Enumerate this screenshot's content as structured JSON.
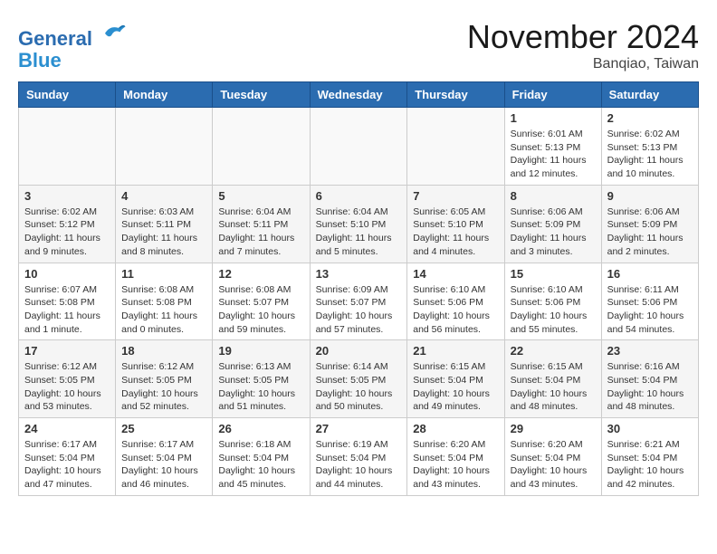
{
  "header": {
    "logo_line1": "General",
    "logo_line2": "Blue",
    "month_title": "November 2024",
    "location": "Banqiao, Taiwan"
  },
  "weekdays": [
    "Sunday",
    "Monday",
    "Tuesday",
    "Wednesday",
    "Thursday",
    "Friday",
    "Saturday"
  ],
  "weeks": [
    [
      {
        "day": "",
        "info": ""
      },
      {
        "day": "",
        "info": ""
      },
      {
        "day": "",
        "info": ""
      },
      {
        "day": "",
        "info": ""
      },
      {
        "day": "",
        "info": ""
      },
      {
        "day": "1",
        "info": "Sunrise: 6:01 AM\nSunset: 5:13 PM\nDaylight: 11 hours and 12 minutes."
      },
      {
        "day": "2",
        "info": "Sunrise: 6:02 AM\nSunset: 5:13 PM\nDaylight: 11 hours and 10 minutes."
      }
    ],
    [
      {
        "day": "3",
        "info": "Sunrise: 6:02 AM\nSunset: 5:12 PM\nDaylight: 11 hours and 9 minutes."
      },
      {
        "day": "4",
        "info": "Sunrise: 6:03 AM\nSunset: 5:11 PM\nDaylight: 11 hours and 8 minutes."
      },
      {
        "day": "5",
        "info": "Sunrise: 6:04 AM\nSunset: 5:11 PM\nDaylight: 11 hours and 7 minutes."
      },
      {
        "day": "6",
        "info": "Sunrise: 6:04 AM\nSunset: 5:10 PM\nDaylight: 11 hours and 5 minutes."
      },
      {
        "day": "7",
        "info": "Sunrise: 6:05 AM\nSunset: 5:10 PM\nDaylight: 11 hours and 4 minutes."
      },
      {
        "day": "8",
        "info": "Sunrise: 6:06 AM\nSunset: 5:09 PM\nDaylight: 11 hours and 3 minutes."
      },
      {
        "day": "9",
        "info": "Sunrise: 6:06 AM\nSunset: 5:09 PM\nDaylight: 11 hours and 2 minutes."
      }
    ],
    [
      {
        "day": "10",
        "info": "Sunrise: 6:07 AM\nSunset: 5:08 PM\nDaylight: 11 hours and 1 minute."
      },
      {
        "day": "11",
        "info": "Sunrise: 6:08 AM\nSunset: 5:08 PM\nDaylight: 11 hours and 0 minutes."
      },
      {
        "day": "12",
        "info": "Sunrise: 6:08 AM\nSunset: 5:07 PM\nDaylight: 10 hours and 59 minutes."
      },
      {
        "day": "13",
        "info": "Sunrise: 6:09 AM\nSunset: 5:07 PM\nDaylight: 10 hours and 57 minutes."
      },
      {
        "day": "14",
        "info": "Sunrise: 6:10 AM\nSunset: 5:06 PM\nDaylight: 10 hours and 56 minutes."
      },
      {
        "day": "15",
        "info": "Sunrise: 6:10 AM\nSunset: 5:06 PM\nDaylight: 10 hours and 55 minutes."
      },
      {
        "day": "16",
        "info": "Sunrise: 6:11 AM\nSunset: 5:06 PM\nDaylight: 10 hours and 54 minutes."
      }
    ],
    [
      {
        "day": "17",
        "info": "Sunrise: 6:12 AM\nSunset: 5:05 PM\nDaylight: 10 hours and 53 minutes."
      },
      {
        "day": "18",
        "info": "Sunrise: 6:12 AM\nSunset: 5:05 PM\nDaylight: 10 hours and 52 minutes."
      },
      {
        "day": "19",
        "info": "Sunrise: 6:13 AM\nSunset: 5:05 PM\nDaylight: 10 hours and 51 minutes."
      },
      {
        "day": "20",
        "info": "Sunrise: 6:14 AM\nSunset: 5:05 PM\nDaylight: 10 hours and 50 minutes."
      },
      {
        "day": "21",
        "info": "Sunrise: 6:15 AM\nSunset: 5:04 PM\nDaylight: 10 hours and 49 minutes."
      },
      {
        "day": "22",
        "info": "Sunrise: 6:15 AM\nSunset: 5:04 PM\nDaylight: 10 hours and 48 minutes."
      },
      {
        "day": "23",
        "info": "Sunrise: 6:16 AM\nSunset: 5:04 PM\nDaylight: 10 hours and 48 minutes."
      }
    ],
    [
      {
        "day": "24",
        "info": "Sunrise: 6:17 AM\nSunset: 5:04 PM\nDaylight: 10 hours and 47 minutes."
      },
      {
        "day": "25",
        "info": "Sunrise: 6:17 AM\nSunset: 5:04 PM\nDaylight: 10 hours and 46 minutes."
      },
      {
        "day": "26",
        "info": "Sunrise: 6:18 AM\nSunset: 5:04 PM\nDaylight: 10 hours and 45 minutes."
      },
      {
        "day": "27",
        "info": "Sunrise: 6:19 AM\nSunset: 5:04 PM\nDaylight: 10 hours and 44 minutes."
      },
      {
        "day": "28",
        "info": "Sunrise: 6:20 AM\nSunset: 5:04 PM\nDaylight: 10 hours and 43 minutes."
      },
      {
        "day": "29",
        "info": "Sunrise: 6:20 AM\nSunset: 5:04 PM\nDaylight: 10 hours and 43 minutes."
      },
      {
        "day": "30",
        "info": "Sunrise: 6:21 AM\nSunset: 5:04 PM\nDaylight: 10 hours and 42 minutes."
      }
    ]
  ]
}
